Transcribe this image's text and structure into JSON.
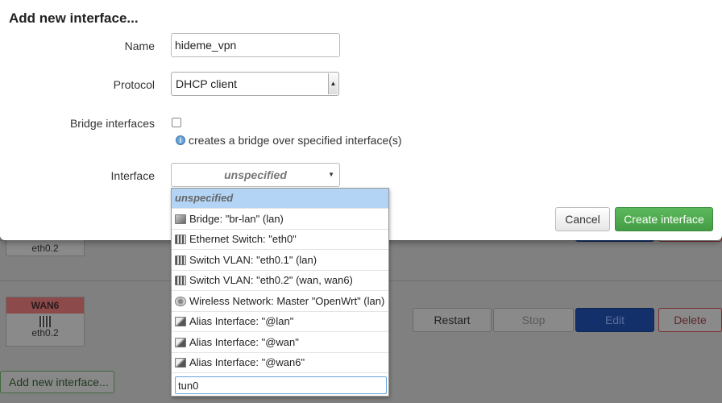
{
  "modal": {
    "title": "Add new interface...",
    "name_label": "Name",
    "name_value": "hideme_vpn",
    "protocol_label": "Protocol",
    "protocol_value": "DHCP client",
    "bridge_label": "Bridge interfaces",
    "bridge_hint": "creates a bridge over specified interface(s)",
    "interface_label": "Interface",
    "interface_value": "unspecified",
    "cancel_label": "Cancel",
    "create_label": "Create interface"
  },
  "dropdown": {
    "items": [
      {
        "label": "unspecified",
        "icon": "none"
      },
      {
        "label": "Bridge: \"br-lan\" (lan)",
        "icon": "bridge-icon"
      },
      {
        "label": "Ethernet Switch: \"eth0\"",
        "icon": "ethernet-icon"
      },
      {
        "label": "Switch VLAN: \"eth0.1\" (lan)",
        "icon": "ethernet-icon"
      },
      {
        "label": "Switch VLAN: \"eth0.2\" (wan, wan6)",
        "icon": "ethernet-icon"
      },
      {
        "label": "Wireless Network: Master \"OpenWrt\" (lan)",
        "icon": "wifi-icon"
      },
      {
        "label": "Alias Interface: \"@lan\"",
        "icon": "alias-icon"
      },
      {
        "label": "Alias Interface: \"@wan\"",
        "icon": "alias-icon"
      },
      {
        "label": "Alias Interface: \"@wan6\"",
        "icon": "alias-icon"
      }
    ],
    "custom_value": "tun0"
  },
  "background": {
    "iface1_device": "eth0.2",
    "iface2_name": "WAN6",
    "iface2_device": "eth0.2",
    "restart_label": "Restart",
    "stop_label": "Stop",
    "edit_label": "Edit",
    "delete_label": "Delete",
    "add_label": "Add new interface..."
  },
  "colors": {
    "accent_green": "#5cb85c",
    "edit_blue": "#13306a",
    "selected_row": "#b3d4f5"
  }
}
